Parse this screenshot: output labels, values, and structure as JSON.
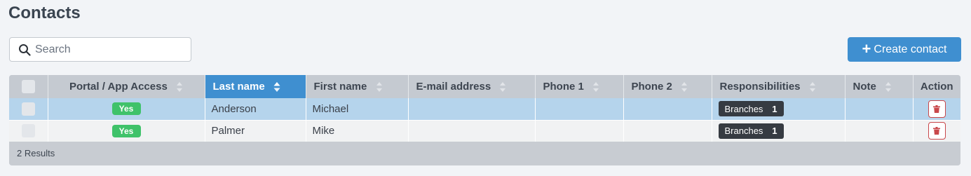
{
  "page": {
    "title": "Contacts"
  },
  "search": {
    "placeholder": "Search",
    "value": ""
  },
  "toolbar": {
    "create_label": "Create contact"
  },
  "table": {
    "columns": [
      {
        "key": "select",
        "label": ""
      },
      {
        "key": "portal",
        "label": "Portal / App Access"
      },
      {
        "key": "last_name",
        "label": "Last name",
        "sorted": "asc"
      },
      {
        "key": "first_name",
        "label": "First name"
      },
      {
        "key": "email",
        "label": "E-mail address"
      },
      {
        "key": "phone1",
        "label": "Phone 1"
      },
      {
        "key": "phone2",
        "label": "Phone 2"
      },
      {
        "key": "responsibilities",
        "label": "Responsibilities"
      },
      {
        "key": "note",
        "label": "Note"
      },
      {
        "key": "action",
        "label": "Action"
      }
    ],
    "rows": [
      {
        "portal": "Yes",
        "last_name": "Anderson",
        "first_name": "Michael",
        "email": "",
        "phone1": "",
        "phone2": "",
        "responsibility": {
          "label": "Branches",
          "count": "1"
        },
        "note": "",
        "selected": true
      },
      {
        "portal": "Yes",
        "last_name": "Palmer",
        "first_name": "Mike",
        "email": "",
        "phone1": "",
        "phone2": "",
        "responsibility": {
          "label": "Branches",
          "count": "1"
        },
        "note": "",
        "selected": false
      }
    ],
    "footer": "2 Results"
  },
  "colors": {
    "accent": "#3f8fd0",
    "success": "#3fc26a",
    "danger": "#c9484b",
    "selected_row": "#b5d4ec"
  },
  "icons": {
    "search": "search-icon",
    "create": "plus-icon",
    "sort": "sort-icon",
    "delete": "trash-icon"
  }
}
